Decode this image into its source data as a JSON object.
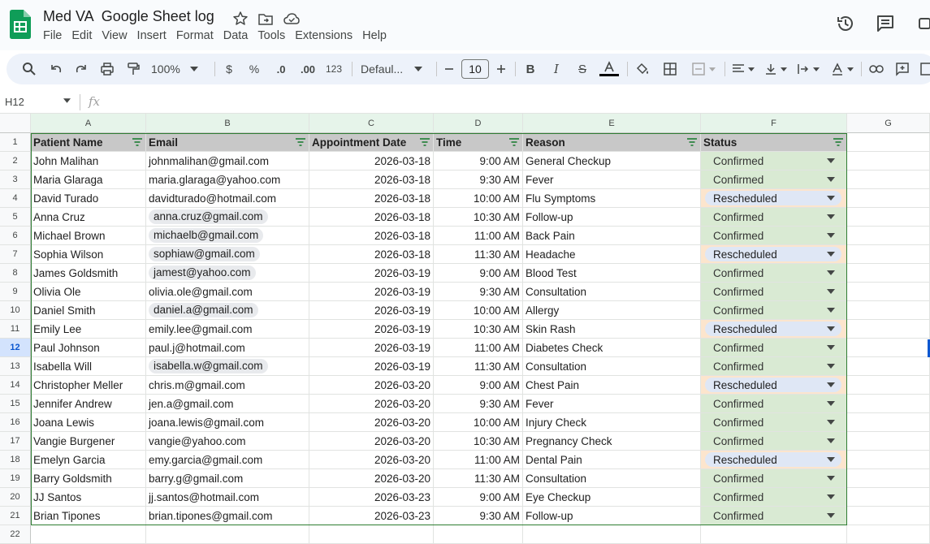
{
  "doc": {
    "title": "Med VA  Google Sheet log",
    "menu": [
      "File",
      "Edit",
      "View",
      "Insert",
      "Format",
      "Data",
      "Tools",
      "Extensions",
      "Help"
    ]
  },
  "toolbar": {
    "zoom": "100%",
    "currency": "$",
    "percent": "%",
    "decrease_decimal": ".0",
    "increase_decimal": ".00",
    "number_format": "123",
    "font": "Defaul...",
    "font_size": "10"
  },
  "formula_bar": {
    "name_box": "H12",
    "fx": "fx"
  },
  "columns": [
    "A",
    "B",
    "C",
    "D",
    "E",
    "F",
    "G"
  ],
  "header_row": [
    "Patient Name",
    "Email",
    "Appointment Date",
    "Time",
    "Reason",
    "Status"
  ],
  "rows": [
    {
      "name": "John Malihan",
      "email": "johnmalihan@gmail.com",
      "email_chip": false,
      "date": "2026-03-18",
      "time": "9:00 AM",
      "reason": "General Checkup",
      "status": "Confirmed"
    },
    {
      "name": "Maria Glaraga",
      "email": "maria.glaraga@yahoo.com",
      "email_chip": false,
      "date": "2026-03-18",
      "time": "9:30 AM",
      "reason": "Fever",
      "status": "Confirmed"
    },
    {
      "name": "David Turado",
      "email": "davidturado@hotmail.com",
      "email_chip": false,
      "date": "2026-03-18",
      "time": "10:00 AM",
      "reason": "Flu Symptoms",
      "status": "Rescheduled"
    },
    {
      "name": "Anna Cruz",
      "email": "anna.cruz@gmail.com",
      "email_chip": true,
      "date": "2026-03-18",
      "time": "10:30 AM",
      "reason": "Follow-up",
      "status": "Confirmed"
    },
    {
      "name": "Michael Brown",
      "email": "michaelb@gmail.com",
      "email_chip": true,
      "date": "2026-03-18",
      "time": "11:00 AM",
      "reason": "Back Pain",
      "status": "Confirmed"
    },
    {
      "name": "Sophia Wilson",
      "email": "sophiaw@gmail.com",
      "email_chip": true,
      "date": "2026-03-18",
      "time": "11:30 AM",
      "reason": "Headache",
      "status": "Rescheduled"
    },
    {
      "name": "James Goldsmith",
      "email": "jamest@yahoo.com",
      "email_chip": true,
      "date": "2026-03-19",
      "time": "9:00 AM",
      "reason": "Blood Test",
      "status": "Confirmed"
    },
    {
      "name": "Olivia Ole",
      "email": "olivia.ole@gmail.com",
      "email_chip": false,
      "date": "2026-03-19",
      "time": "9:30 AM",
      "reason": "Consultation",
      "status": "Confirmed"
    },
    {
      "name": "Daniel Smith",
      "email": "daniel.a@gmail.com",
      "email_chip": true,
      "date": "2026-03-19",
      "time": "10:00 AM",
      "reason": "Allergy",
      "status": "Confirmed"
    },
    {
      "name": "Emily Lee",
      "email": "emily.lee@gmail.com",
      "email_chip": false,
      "date": "2026-03-19",
      "time": "10:30 AM",
      "reason": "Skin Rash",
      "status": "Rescheduled"
    },
    {
      "name": "Paul Johnson",
      "email": "paul.j@hotmail.com",
      "email_chip": false,
      "date": "2026-03-19",
      "time": "11:00 AM",
      "reason": "Diabetes Check",
      "status": "Confirmed"
    },
    {
      "name": "Isabella Will",
      "email": "isabella.w@gmail.com",
      "email_chip": true,
      "date": "2026-03-19",
      "time": "11:30 AM",
      "reason": "Consultation",
      "status": "Confirmed"
    },
    {
      "name": "Christopher Meller",
      "email": "chris.m@gmail.com",
      "email_chip": false,
      "date": "2026-03-20",
      "time": "9:00 AM",
      "reason": "Chest Pain",
      "status": "Rescheduled"
    },
    {
      "name": "Jennifer Andrew",
      "email": "jen.a@gmail.com",
      "email_chip": false,
      "date": "2026-03-20",
      "time": "9:30 AM",
      "reason": "Fever",
      "status": "Confirmed"
    },
    {
      "name": "Joana Lewis",
      "email": "joana.lewis@gmail.com",
      "email_chip": false,
      "date": "2026-03-20",
      "time": "10:00 AM",
      "reason": "Injury Check",
      "status": "Confirmed"
    },
    {
      "name": "Vangie Burgener",
      "email": "vangie@yahoo.com",
      "email_chip": false,
      "date": "2026-03-20",
      "time": "10:30 AM",
      "reason": "Pregnancy Check",
      "status": "Confirmed"
    },
    {
      "name": "Emelyn Garcia",
      "email": "emy.garcia@gmail.com",
      "email_chip": false,
      "date": "2026-03-20",
      "time": "11:00 AM",
      "reason": "Dental Pain",
      "status": "Rescheduled"
    },
    {
      "name": "Barry Goldsmith",
      "email": "barry.g@gmail.com",
      "email_chip": false,
      "date": "2026-03-20",
      "time": "11:30 AM",
      "reason": "Consultation",
      "status": "Confirmed"
    },
    {
      "name": "JJ Santos",
      "email": "jj.santos@hotmail.com",
      "email_chip": false,
      "date": "2026-03-23",
      "time": "9:00 AM",
      "reason": "Eye Checkup",
      "status": "Confirmed"
    },
    {
      "name": "Brian Tipones",
      "email": "brian.tipones@gmail.com",
      "email_chip": false,
      "date": "2026-03-23",
      "time": "9:30 AM",
      "reason": "Follow-up",
      "status": "Confirmed"
    }
  ],
  "row_numbers": [
    "1",
    "2",
    "3",
    "4",
    "5",
    "6",
    "7",
    "8",
    "9",
    "10",
    "11",
    "12",
    "13",
    "14",
    "15",
    "16",
    "17",
    "18",
    "19",
    "20",
    "21",
    "22"
  ],
  "colors": {
    "sheets_green": "#0f9d58",
    "confirmed_bg": "#d9ead3",
    "rescheduled_bg": "#fce5cd",
    "rescheduled_chip": "#dfe7f5",
    "header_bg": "#c8c8c8",
    "selection_blue": "#0b57d0"
  }
}
